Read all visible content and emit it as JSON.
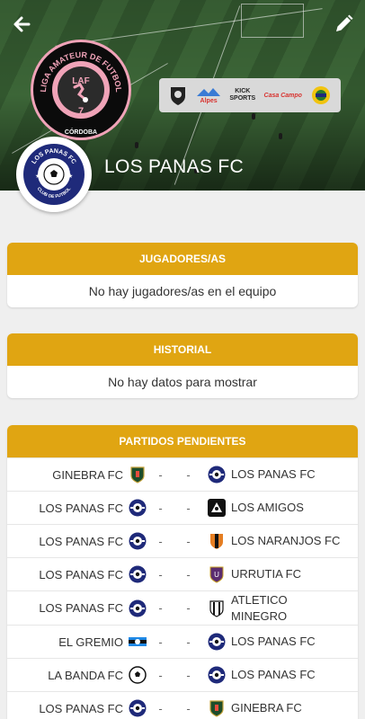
{
  "header": {
    "team_name": "LOS PANAS FC",
    "league_logo_text": {
      "arc_text": "LIGA AMATEUR DE FUTBOL",
      "center": "LAF",
      "number": "7",
      "city": "CÓRDOBA"
    },
    "club_logo_text": {
      "top": "LOS PANAS FC",
      "bottom": "CLUB DE FUTBOL"
    },
    "sponsors": [
      "Alpes",
      "KICK SPORTS",
      "Casa Campo"
    ]
  },
  "players_section": {
    "title": "JUGADORES/AS",
    "empty_text": "No hay jugadores/as en el equipo"
  },
  "history_section": {
    "title": "HISTORIAL",
    "empty_text": "No hay datos para mostrar"
  },
  "pending_section": {
    "title": "PARTIDOS PENDIENTES",
    "matches": [
      {
        "home": "GINEBRA FC",
        "home_badge": "ginebra",
        "home_score": "-",
        "away_score": "-",
        "away": "LOS PANAS FC",
        "away_badge": "panas"
      },
      {
        "home": "LOS PANAS FC",
        "home_badge": "panas",
        "home_score": "-",
        "away_score": "-",
        "away": "LOS AMIGOS",
        "away_badge": "amigos"
      },
      {
        "home": "LOS PANAS FC",
        "home_badge": "panas",
        "home_score": "-",
        "away_score": "-",
        "away": "LOS NARANJOS FC",
        "away_badge": "naranjos"
      },
      {
        "home": "LOS PANAS FC",
        "home_badge": "panas",
        "home_score": "-",
        "away_score": "-",
        "away": "URRUTIA FC",
        "away_badge": "urrutia"
      },
      {
        "home": "LOS PANAS FC",
        "home_badge": "panas",
        "home_score": "-",
        "away_score": "-",
        "away": "ATLETICO MINEGRO",
        "away_badge": "minegro"
      },
      {
        "home": "EL GREMIO",
        "home_badge": "gremio",
        "home_score": "-",
        "away_score": "-",
        "away": "LOS PANAS FC",
        "away_badge": "panas"
      },
      {
        "home": "LA BANDA FC",
        "home_badge": "banda",
        "home_score": "-",
        "away_score": "-",
        "away": "LOS PANAS FC",
        "away_badge": "panas"
      },
      {
        "home": "LOS PANAS FC",
        "home_badge": "panas",
        "home_score": "-",
        "away_score": "-",
        "away": "GINEBRA FC",
        "away_badge": "ginebra"
      }
    ]
  },
  "colors": {
    "accent": "#e0a512",
    "club_blue": "#1f2a7a",
    "league_pink": "#f0a3b8"
  },
  "icons": {
    "back": "arrow-left-icon",
    "edit": "pencil-icon"
  }
}
